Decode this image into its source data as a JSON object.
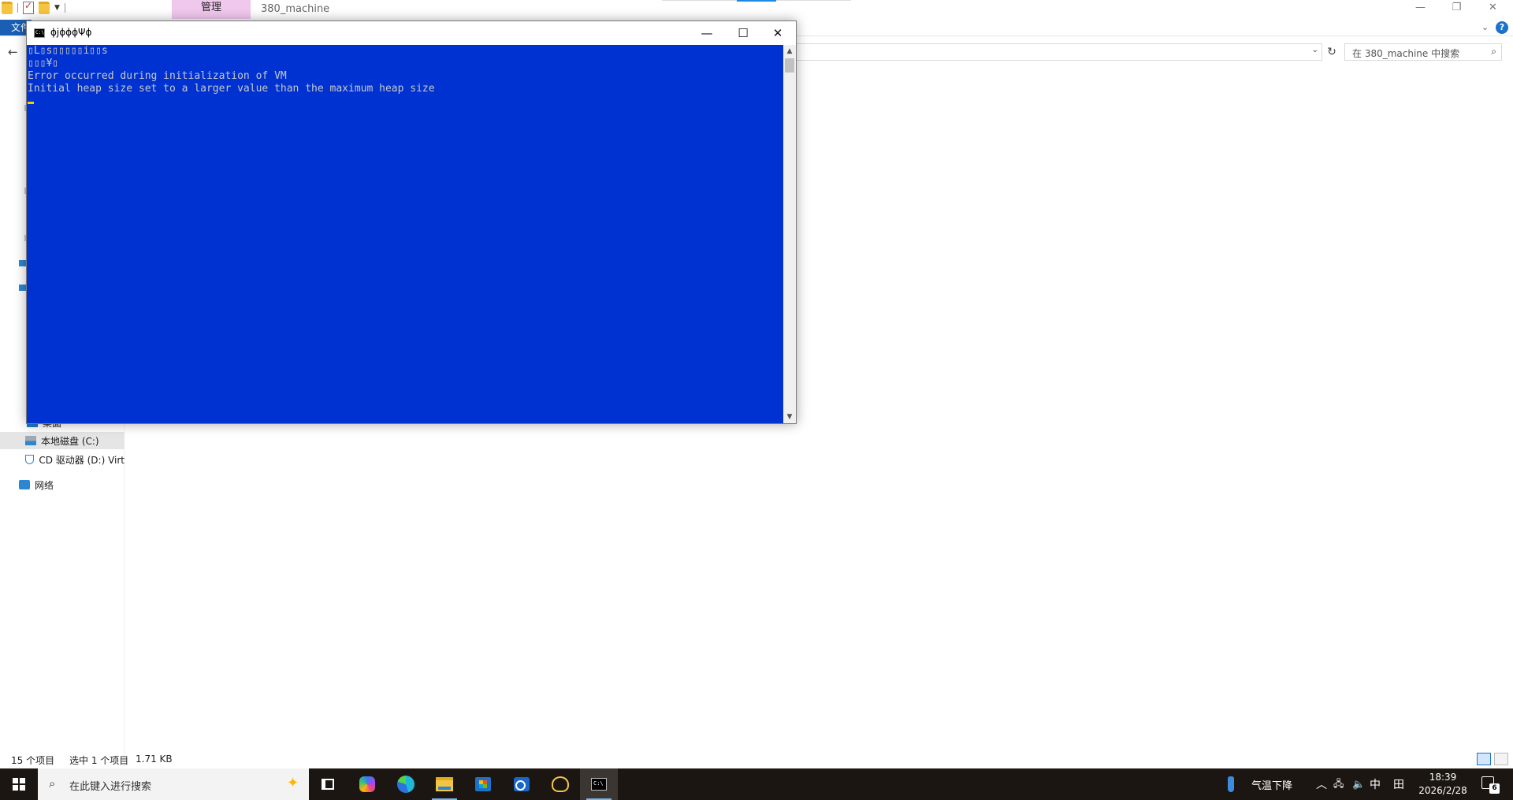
{
  "explorer": {
    "manage_tab": "管理",
    "title": "380_machine",
    "file_tab": "文件",
    "search_placeholder": "在 380_machine 中搜索",
    "window_controls": {
      "minimize": "—",
      "restore": "❐",
      "close": "✕"
    },
    "nav": {
      "desktop": "桌面",
      "local_disk": "本地磁盘 (C:)",
      "cd_drive": "CD 驱动器 (D:) Virt",
      "network": "网络"
    },
    "status": {
      "item_count": "15 个项目",
      "selected": "选中 1 个项目",
      "size": "1.71 KB"
    }
  },
  "console": {
    "title": "ɸjɸɸɸΨɸ",
    "lines": [
      "▯L▯s▯▯▯▯▯i▯▯s",
      "▯▯▯¥▯",
      "Error occurred during initialization of VM",
      "Initial heap size set to a larger value than the maximum heap size"
    ],
    "buttons": {
      "minimize": "—",
      "maximize": "☐",
      "close": "✕"
    }
  },
  "taskbar": {
    "search_placeholder": "在此键入进行搜索",
    "weather": "气温下降",
    "ime": "中",
    "time": "18:39",
    "date": "2026/2/28",
    "notification_count": "6"
  },
  "colors": {
    "console_bg": "#0032d2",
    "console_text": "#c8c8c8",
    "manage_tab": "#f0c8ee",
    "file_tab": "#1a5fb4",
    "taskbar": "#1b1611"
  }
}
